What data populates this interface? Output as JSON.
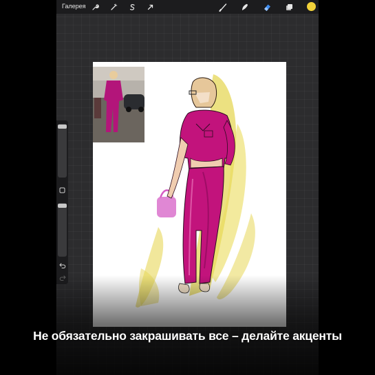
{
  "topbar": {
    "gallery_label": "Галерея",
    "color_swatch": "#f2d23a"
  },
  "icons": {
    "actions": "wrench-icon",
    "adjustments": "magic-wand-icon",
    "selection": "selection-s-icon",
    "transform": "arrow-cursor-icon",
    "brush": "brush-icon",
    "smudge": "smudge-icon",
    "eraser": "eraser-icon",
    "layers": "layers-icon",
    "modify": "square-modify-icon",
    "undo": "undo-icon",
    "redo": "redo-icon"
  },
  "sidebar": {
    "brush_size_level": 0.02,
    "opacity_level": 0.02
  },
  "colors": {
    "accent_magenta": "#c2137c",
    "accent_yellow": "#e2d03a"
  },
  "caption": "Не обязательно закрашивать все – делайте акценты"
}
